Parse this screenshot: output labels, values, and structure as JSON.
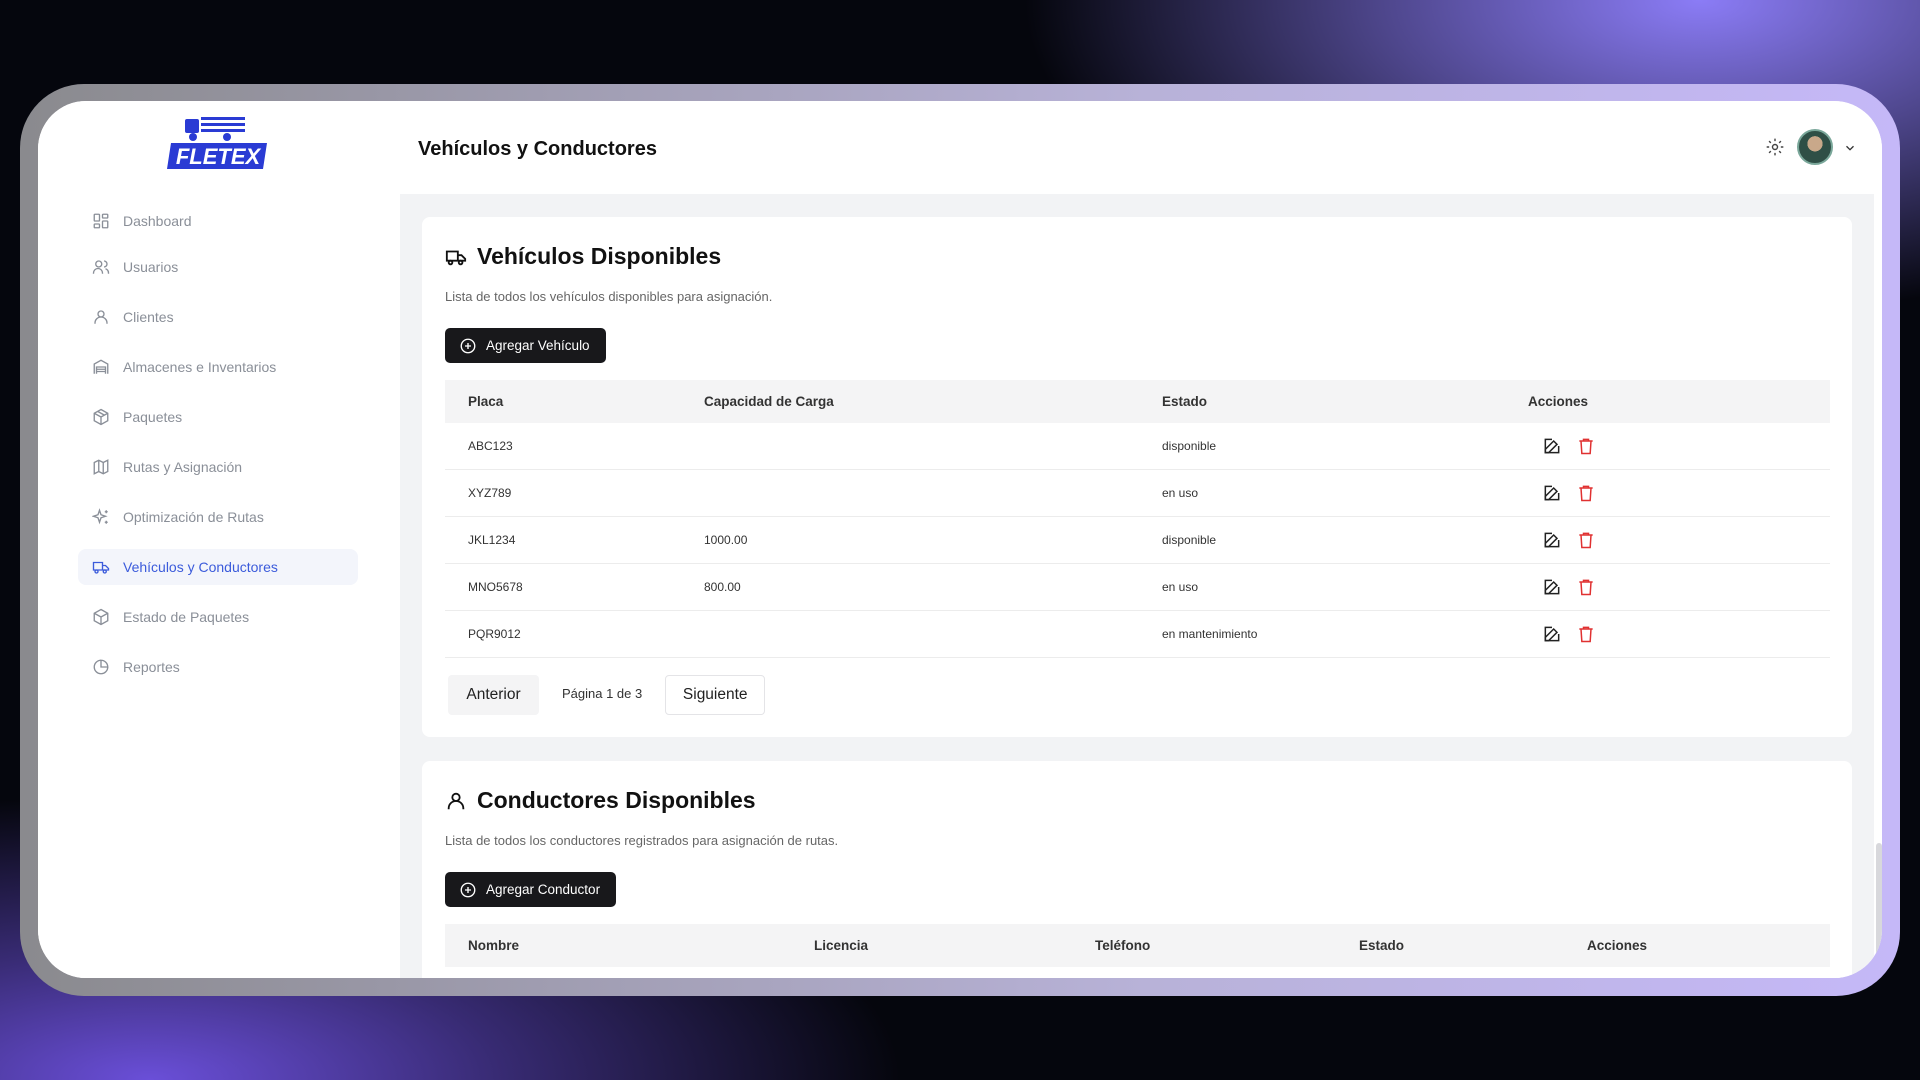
{
  "app": {
    "logo_text": "FLETEX",
    "brand_color": "#2a3bd4"
  },
  "sidebar": {
    "items": [
      {
        "label": "Dashboard",
        "icon": "grid-icon"
      },
      {
        "label": "Usuarios",
        "icon": "users-icon"
      },
      {
        "label": "Clientes",
        "icon": "user-icon"
      },
      {
        "label": "Almacenes e Inventarios",
        "icon": "warehouse-icon"
      },
      {
        "label": "Paquetes",
        "icon": "package-icon"
      },
      {
        "label": "Rutas y Asignación",
        "icon": "map-icon"
      },
      {
        "label": "Optimización de Rutas",
        "icon": "sparkles-icon"
      },
      {
        "label": "Vehículos y Conductores",
        "icon": "truck-icon",
        "active": true
      },
      {
        "label": "Estado de Paquetes",
        "icon": "package-check-icon"
      },
      {
        "label": "Reportes",
        "icon": "pie-chart-icon"
      }
    ]
  },
  "header": {
    "title": "Vehículos y Conductores"
  },
  "vehicles": {
    "title": "Vehículos Disponibles",
    "description": "Lista de todos los vehículos disponibles para asignación.",
    "add_label": "Agregar Vehículo",
    "columns": [
      "Placa",
      "Capacidad de Carga",
      "Estado",
      "Acciones"
    ],
    "rows": [
      {
        "placa": "ABC123",
        "capacidad": "",
        "estado": "disponible"
      },
      {
        "placa": "XYZ789",
        "capacidad": "",
        "estado": "en uso"
      },
      {
        "placa": "JKL1234",
        "capacidad": "1000.00",
        "estado": "disponible"
      },
      {
        "placa": "MNO5678",
        "capacidad": "800.00",
        "estado": "en uso"
      },
      {
        "placa": "PQR9012",
        "capacidad": "",
        "estado": "en mantenimiento"
      }
    ],
    "pagination": {
      "prev_label": "Anterior",
      "page_info": "Página 1 de 3",
      "next_label": "Siguiente"
    }
  },
  "drivers": {
    "title": "Conductores Disponibles",
    "description": "Lista de todos los conductores registrados para asignación de rutas.",
    "add_label": "Agregar Conductor",
    "columns": [
      "Nombre",
      "Licencia",
      "Teléfono",
      "Estado",
      "Acciones"
    ]
  },
  "colors": {
    "delete": "#e03131",
    "active_nav": "#3b5bdb"
  }
}
